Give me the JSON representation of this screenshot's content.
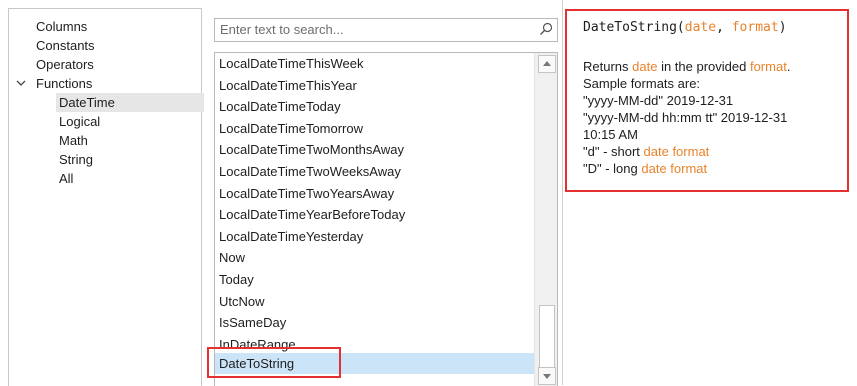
{
  "categories": {
    "items": [
      "Columns",
      "Constants",
      "Operators",
      "Functions",
      "DateTime",
      "Logical",
      "Math",
      "String",
      "All"
    ],
    "selected": "DateTime"
  },
  "search": {
    "placeholder": "Enter text to search..."
  },
  "functions": {
    "items": [
      "LocalDateTimeThisWeek",
      "LocalDateTimeThisYear",
      "LocalDateTimeToday",
      "LocalDateTimeTomorrow",
      "LocalDateTimeTwoMonthsAway",
      "LocalDateTimeTwoWeeksAway",
      "LocalDateTimeTwoYearsAway",
      "LocalDateTimeYearBeforeToday",
      "LocalDateTimeYesterday",
      "Now",
      "Today",
      "UtcNow",
      "IsSameDay",
      "InDateRange",
      "DateToString"
    ],
    "selected": "DateToString"
  },
  "description": {
    "sig_name": "DateToString(",
    "sig_p1": "date",
    "sig_sep": ", ",
    "sig_p2": "format",
    "sig_close": ")",
    "returns_pre": "Returns ",
    "returns_p1": "date",
    "returns_mid": " in the provided ",
    "returns_p2": "format",
    "returns_end": ".",
    "sample_intro": "Sample formats are:",
    "sample1": "\"yyyy-MM-dd\" 2019-12-31",
    "sample2": "\"yyyy-MM-dd hh:mm tt\" 2019-12-31",
    "sample2b": "10:15 AM",
    "d_pre": "\"d\" - short ",
    "d_link": "date format",
    "D_pre": "\"D\" - long ",
    "D_link": "date format"
  },
  "colors": {
    "param": "#e8832b",
    "selection": "#cce4f7",
    "highlight_box": "#e53030"
  }
}
